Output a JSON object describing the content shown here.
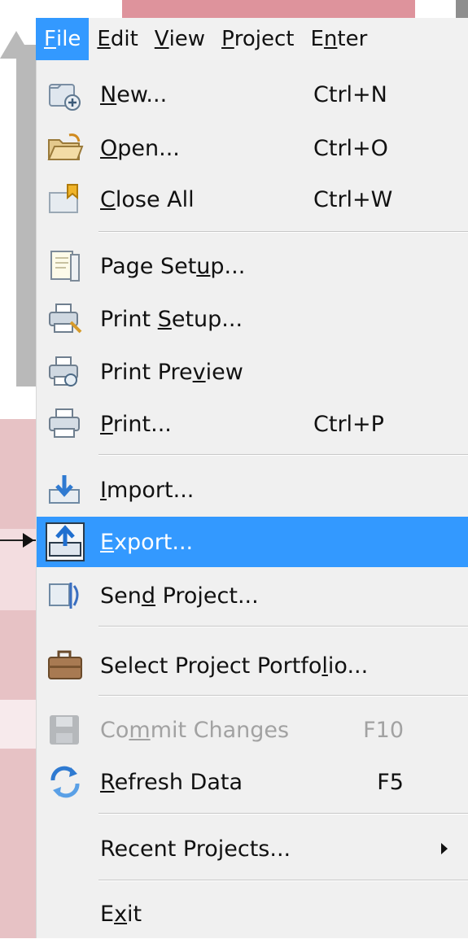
{
  "menubar": {
    "items": [
      {
        "label": "File",
        "mnemonic": "F",
        "active": true
      },
      {
        "label": "Edit",
        "mnemonic": "E"
      },
      {
        "label": "View",
        "mnemonic": "V"
      },
      {
        "label": "Project",
        "mnemonic": "P"
      },
      {
        "label": "Enter",
        "mnemonic": "n"
      }
    ]
  },
  "file_menu": {
    "items": [
      {
        "pre": "",
        "mn": "N",
        "post": "ew...",
        "shortcut": "Ctrl+N",
        "icon": "new-project-icon"
      },
      {
        "pre": "",
        "mn": "O",
        "post": "pen...",
        "shortcut": "Ctrl+O",
        "icon": "open-folder-icon"
      },
      {
        "pre": "",
        "mn": "C",
        "post": "lose All",
        "shortcut": "Ctrl+W",
        "icon": "close-all-icon"
      },
      {
        "pre": "Page Set",
        "mn": "u",
        "post": "p...",
        "shortcut": "",
        "icon": "page-setup-icon"
      },
      {
        "pre": "Print ",
        "mn": "S",
        "post": "etup...",
        "shortcut": "",
        "icon": "print-setup-icon"
      },
      {
        "pre": "Print Pre",
        "mn": "v",
        "post": "iew",
        "shortcut": "",
        "icon": "print-preview-icon"
      },
      {
        "pre": "",
        "mn": "P",
        "post": "rint...",
        "shortcut": "Ctrl+P",
        "icon": "printer-icon"
      },
      {
        "pre": "",
        "mn": "I",
        "post": "mport...",
        "shortcut": "",
        "icon": "import-icon"
      },
      {
        "pre": "",
        "mn": "E",
        "post": "xport...",
        "shortcut": "",
        "icon": "export-icon"
      },
      {
        "pre": "Sen",
        "mn": "d",
        "post": " Project...",
        "shortcut": "",
        "icon": "send-project-icon"
      },
      {
        "pre": "Select Project Portfo",
        "mn": "l",
        "post": "io...",
        "shortcut": "",
        "icon": "portfolio-briefcase-icon"
      },
      {
        "pre": "Co",
        "mn": "m",
        "post": "mit Changes",
        "shortcut": "F10",
        "icon": "save-disk-icon"
      },
      {
        "pre": "",
        "mn": "R",
        "post": "efresh Data",
        "shortcut": "F5",
        "icon": "refresh-icon"
      },
      {
        "pre": "Recent Pro",
        "mn": "j",
        "post": "ects...",
        "shortcut": "",
        "icon": "submenu-arrow-icon"
      },
      {
        "pre": "E",
        "mn": "x",
        "post": "it",
        "shortcut": "",
        "icon": ""
      }
    ]
  },
  "colors": {
    "menu_bg": "#f0f0f0",
    "highlight": "#3399ff",
    "disabled_text": "#a2a2a2"
  }
}
